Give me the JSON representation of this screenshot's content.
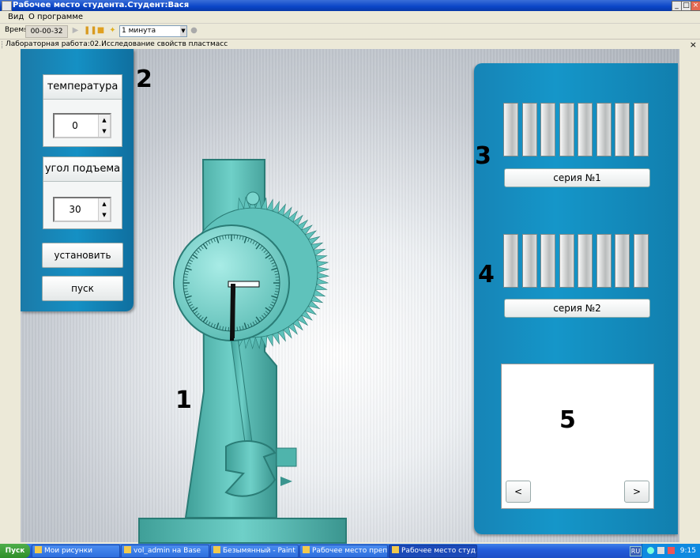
{
  "window": {
    "title": "Рабочее место студента.Студент:Вася",
    "min": "_",
    "max": "□",
    "close": "×"
  },
  "menu": [
    "Вид",
    "О программе"
  ],
  "toolbar": {
    "time_label": "Время",
    "time_value": "00-00-32",
    "interval": "1 минута",
    "icons": [
      "play-icon",
      "pause-icon",
      "stop-icon",
      "star-icon"
    ]
  },
  "doc_tab": {
    "title": "Лабораторная работа:02.Исследование свойств пластмасс",
    "close": "×"
  },
  "controls": {
    "temperature": {
      "label": "температура",
      "value": "0"
    },
    "angle": {
      "label": "угол подъема",
      "value": "30"
    },
    "set_button": "установить",
    "start_button": "пуск"
  },
  "series": [
    {
      "label": "серия №1",
      "specimens": 8
    },
    {
      "label": "серия №2",
      "specimens": 8
    }
  ],
  "viewer": {
    "prev": "<",
    "next": ">"
  },
  "annotations": {
    "n1": "1",
    "n2": "2",
    "n3": "3",
    "n4": "4",
    "n5": "5"
  },
  "taskbar": {
    "start": "Пуск",
    "tasks": [
      "Мои рисунки",
      "vol_admin на Base",
      "Безымянный - Paint",
      "Рабочее место препода...",
      "Рабочее место студ..."
    ],
    "lang": "RU",
    "clock": "9:15"
  },
  "colors": {
    "panel": "#1590c4",
    "machine": "#5fc2bb",
    "machine_dark": "#2f8f88"
  }
}
